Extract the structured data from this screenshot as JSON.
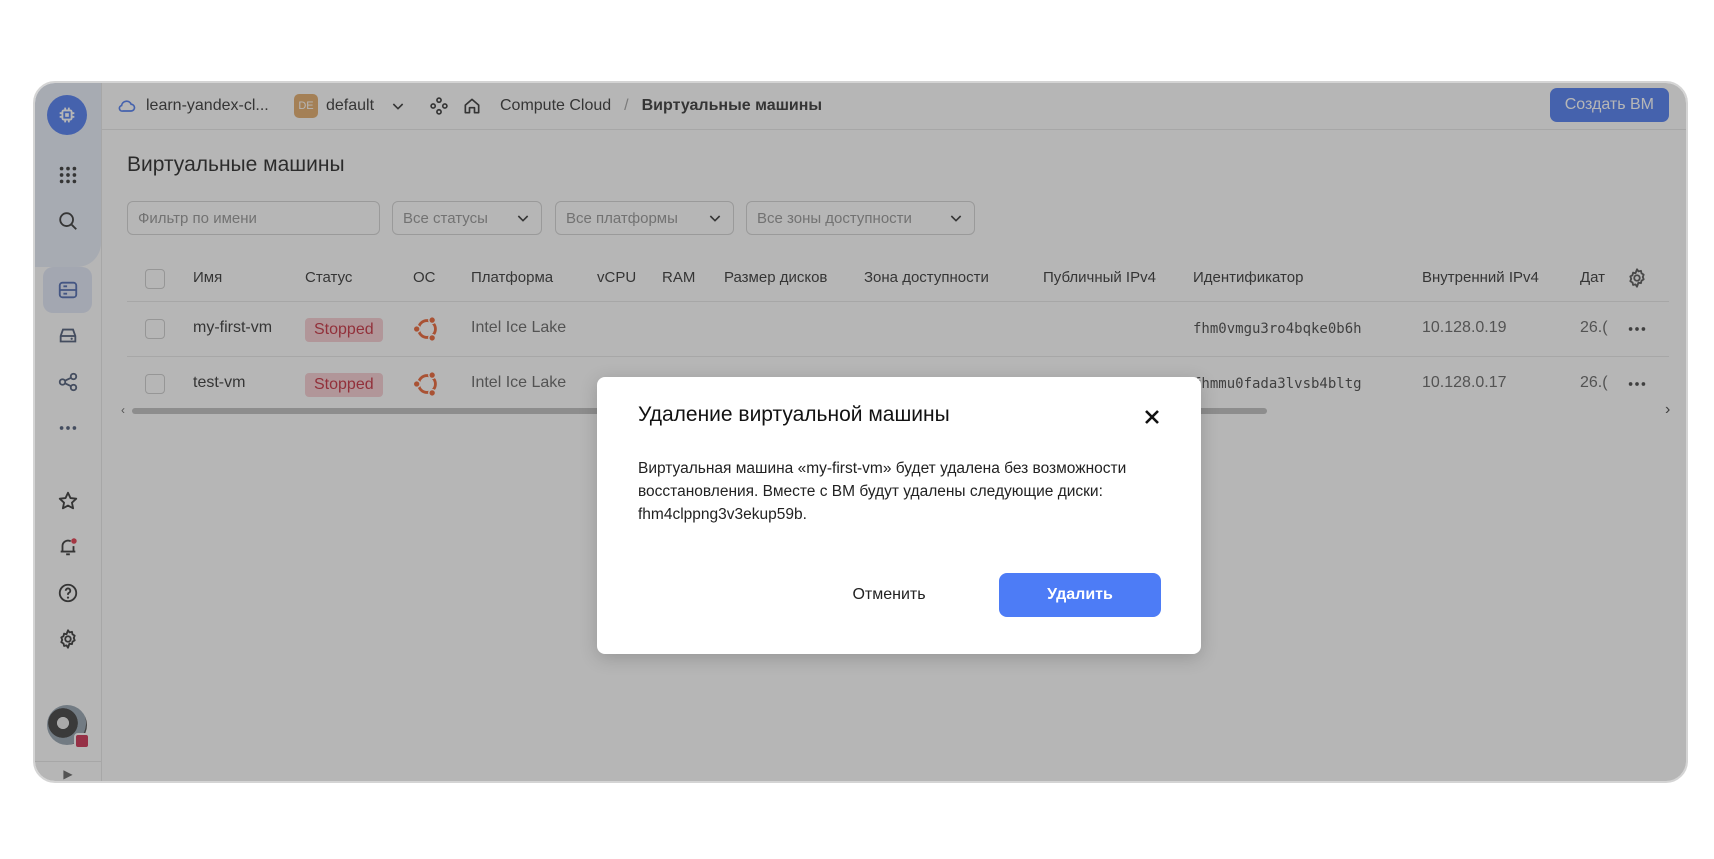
{
  "header": {
    "cloud_name": "learn-yandex-cl...",
    "folder_badge": "DE",
    "folder_name": "default",
    "breadcrumb_service": "Compute Cloud",
    "breadcrumb_separator": "/",
    "breadcrumb_current": "Виртуальные машины",
    "create_button": "Создать ВМ"
  },
  "page": {
    "title": "Виртуальные машины"
  },
  "filters": {
    "name_placeholder": "Фильтр по имени",
    "status": "Все статусы",
    "platform": "Все платформы",
    "zone": "Все зоны доступности"
  },
  "table": {
    "columns": {
      "name": "Имя",
      "status": "Статус",
      "os": "ОС",
      "platform": "Платформа",
      "vcpu": "vCPU",
      "ram": "RAM",
      "disk_size": "Размер дисков",
      "zone": "Зона доступности",
      "public_ip": "Публичный IPv4",
      "id": "Идентификатор",
      "internal_ip": "Внутренний IPv4",
      "date": "Дат"
    },
    "rows": [
      {
        "name": "my-first-vm",
        "status": "Stopped",
        "os": "ubuntu",
        "platform": "Intel Ice Lake",
        "id": "fhm0vmgu3ro4bqke0b6h",
        "internal_ip": "10.128.0.19",
        "date": "26.("
      },
      {
        "name": "test-vm",
        "status": "Stopped",
        "os": "ubuntu",
        "platform": "Intel Ice Lake",
        "id": "fhmmu0fada3lvsb4bltg",
        "internal_ip": "10.128.0.17",
        "date": "26.("
      }
    ]
  },
  "modal": {
    "title": "Удаление виртуальной машины",
    "text_line1": "Виртуальная машина «my-first-vm» будет удалена без возможности",
    "text_line2": "восстановления. Вместе с ВМ будут удалены следующие диски:",
    "text_line3": "fhm4clppng3v3ekup59b.",
    "cancel_label": "Отменить",
    "delete_label": "Удалить"
  },
  "icons": {
    "logo": "compute-cloud-logo-icon",
    "apps": "apps-grid-icon",
    "search": "search-icon",
    "vm": "vm-list-icon",
    "disks": "disk-icon",
    "network": "network-icon",
    "more": "more-icon",
    "favorites": "star-icon",
    "notifications": "bell-icon",
    "help": "help-icon",
    "settings": "gear-icon"
  },
  "colors": {
    "accent": "#3d6ef0",
    "stopped_bg": "#f6c9ce",
    "stopped_text": "#c1192a",
    "ubuntu": "#e95420"
  }
}
